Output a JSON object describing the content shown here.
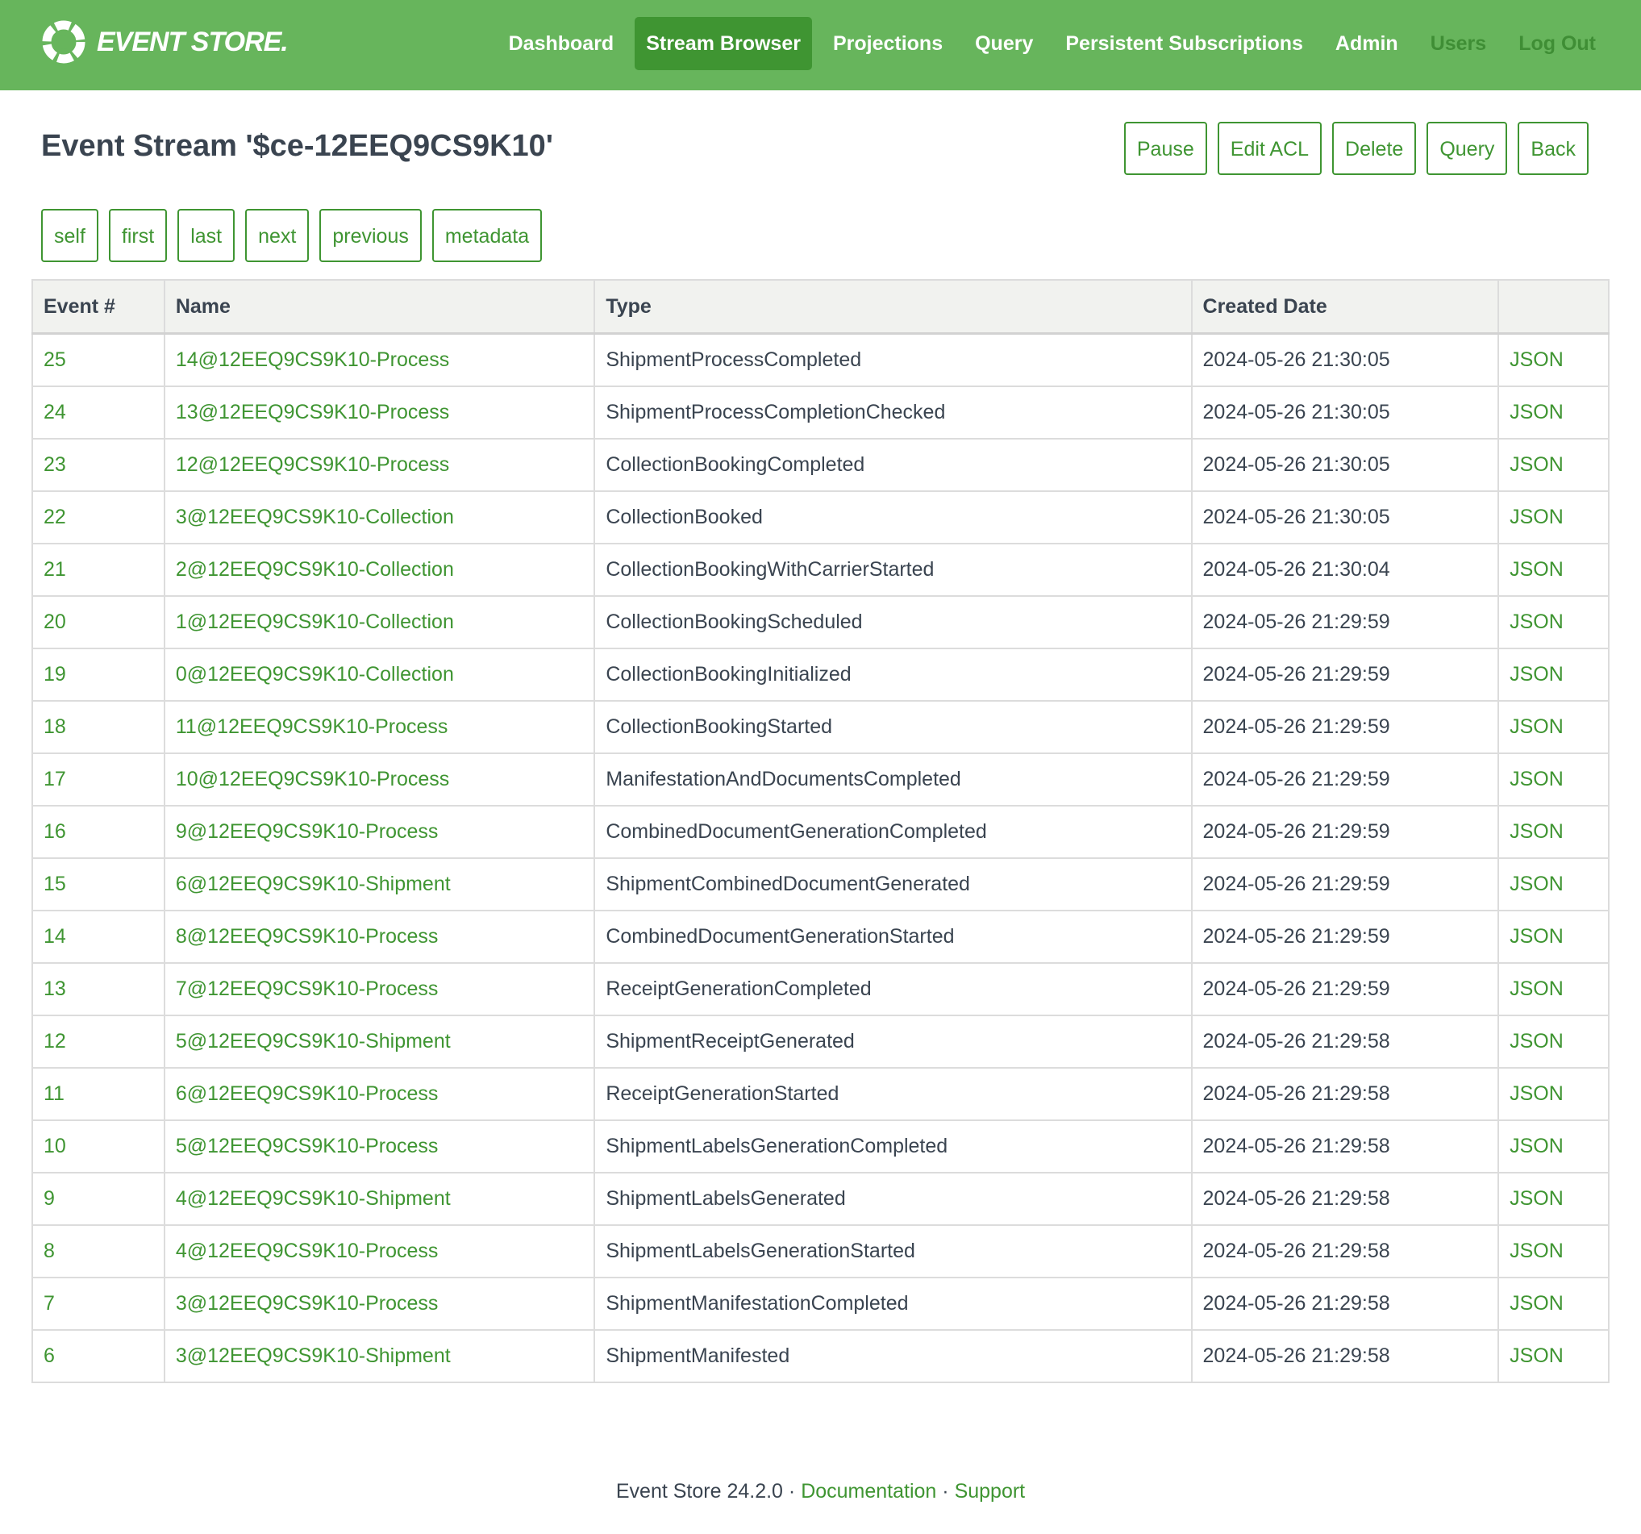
{
  "brand": {
    "name": "EVENT STORE."
  },
  "nav": [
    {
      "label": "Dashboard",
      "state": "normal"
    },
    {
      "label": "Stream Browser",
      "state": "active"
    },
    {
      "label": "Projections",
      "state": "normal"
    },
    {
      "label": "Query",
      "state": "normal"
    },
    {
      "label": "Persistent Subscriptions",
      "state": "normal"
    },
    {
      "label": "Admin",
      "state": "normal"
    },
    {
      "label": "Users",
      "state": "muted"
    },
    {
      "label": "Log Out",
      "state": "muted"
    }
  ],
  "page": {
    "title": "Event Stream '$ce-12EEQ9CS9K10'"
  },
  "actions": [
    "Pause",
    "Edit ACL",
    "Delete",
    "Query",
    "Back"
  ],
  "links": [
    "self",
    "first",
    "last",
    "next",
    "previous",
    "metadata"
  ],
  "table": {
    "columns": [
      "Event #",
      "Name",
      "Type",
      "Created Date",
      ""
    ],
    "rows": [
      {
        "event": "25",
        "name": "14@12EEQ9CS9K10-Process",
        "type": "ShipmentProcessCompleted",
        "created": "2024-05-26 21:30:05",
        "json": "JSON"
      },
      {
        "event": "24",
        "name": "13@12EEQ9CS9K10-Process",
        "type": "ShipmentProcessCompletionChecked",
        "created": "2024-05-26 21:30:05",
        "json": "JSON"
      },
      {
        "event": "23",
        "name": "12@12EEQ9CS9K10-Process",
        "type": "CollectionBookingCompleted",
        "created": "2024-05-26 21:30:05",
        "json": "JSON"
      },
      {
        "event": "22",
        "name": "3@12EEQ9CS9K10-Collection",
        "type": "CollectionBooked",
        "created": "2024-05-26 21:30:05",
        "json": "JSON"
      },
      {
        "event": "21",
        "name": "2@12EEQ9CS9K10-Collection",
        "type": "CollectionBookingWithCarrierStarted",
        "created": "2024-05-26 21:30:04",
        "json": "JSON"
      },
      {
        "event": "20",
        "name": "1@12EEQ9CS9K10-Collection",
        "type": "CollectionBookingScheduled",
        "created": "2024-05-26 21:29:59",
        "json": "JSON"
      },
      {
        "event": "19",
        "name": "0@12EEQ9CS9K10-Collection",
        "type": "CollectionBookingInitialized",
        "created": "2024-05-26 21:29:59",
        "json": "JSON"
      },
      {
        "event": "18",
        "name": "11@12EEQ9CS9K10-Process",
        "type": "CollectionBookingStarted",
        "created": "2024-05-26 21:29:59",
        "json": "JSON"
      },
      {
        "event": "17",
        "name": "10@12EEQ9CS9K10-Process",
        "type": "ManifestationAndDocumentsCompleted",
        "created": "2024-05-26 21:29:59",
        "json": "JSON"
      },
      {
        "event": "16",
        "name": "9@12EEQ9CS9K10-Process",
        "type": "CombinedDocumentGenerationCompleted",
        "created": "2024-05-26 21:29:59",
        "json": "JSON"
      },
      {
        "event": "15",
        "name": "6@12EEQ9CS9K10-Shipment",
        "type": "ShipmentCombinedDocumentGenerated",
        "created": "2024-05-26 21:29:59",
        "json": "JSON"
      },
      {
        "event": "14",
        "name": "8@12EEQ9CS9K10-Process",
        "type": "CombinedDocumentGenerationStarted",
        "created": "2024-05-26 21:29:59",
        "json": "JSON"
      },
      {
        "event": "13",
        "name": "7@12EEQ9CS9K10-Process",
        "type": "ReceiptGenerationCompleted",
        "created": "2024-05-26 21:29:59",
        "json": "JSON"
      },
      {
        "event": "12",
        "name": "5@12EEQ9CS9K10-Shipment",
        "type": "ShipmentReceiptGenerated",
        "created": "2024-05-26 21:29:58",
        "json": "JSON"
      },
      {
        "event": "11",
        "name": "6@12EEQ9CS9K10-Process",
        "type": "ReceiptGenerationStarted",
        "created": "2024-05-26 21:29:58",
        "json": "JSON"
      },
      {
        "event": "10",
        "name": "5@12EEQ9CS9K10-Process",
        "type": "ShipmentLabelsGenerationCompleted",
        "created": "2024-05-26 21:29:58",
        "json": "JSON"
      },
      {
        "event": "9",
        "name": "4@12EEQ9CS9K10-Shipment",
        "type": "ShipmentLabelsGenerated",
        "created": "2024-05-26 21:29:58",
        "json": "JSON"
      },
      {
        "event": "8",
        "name": "4@12EEQ9CS9K10-Process",
        "type": "ShipmentLabelsGenerationStarted",
        "created": "2024-05-26 21:29:58",
        "json": "JSON"
      },
      {
        "event": "7",
        "name": "3@12EEQ9CS9K10-Process",
        "type": "ShipmentManifestationCompleted",
        "created": "2024-05-26 21:29:58",
        "json": "JSON"
      },
      {
        "event": "6",
        "name": "3@12EEQ9CS9K10-Shipment",
        "type": "ShipmentManifested",
        "created": "2024-05-26 21:29:58",
        "json": "JSON"
      }
    ]
  },
  "footer": {
    "version": "Event Store 24.2.0",
    "separator": " · ",
    "documentation": "Documentation",
    "support": "Support"
  },
  "colors": {
    "header_bg": "#67b55c",
    "active_nav": "#3f9532",
    "accent": "#3f9532",
    "text": "#3a4450"
  },
  "icons": {
    "logo": "event-store-ring-icon"
  }
}
